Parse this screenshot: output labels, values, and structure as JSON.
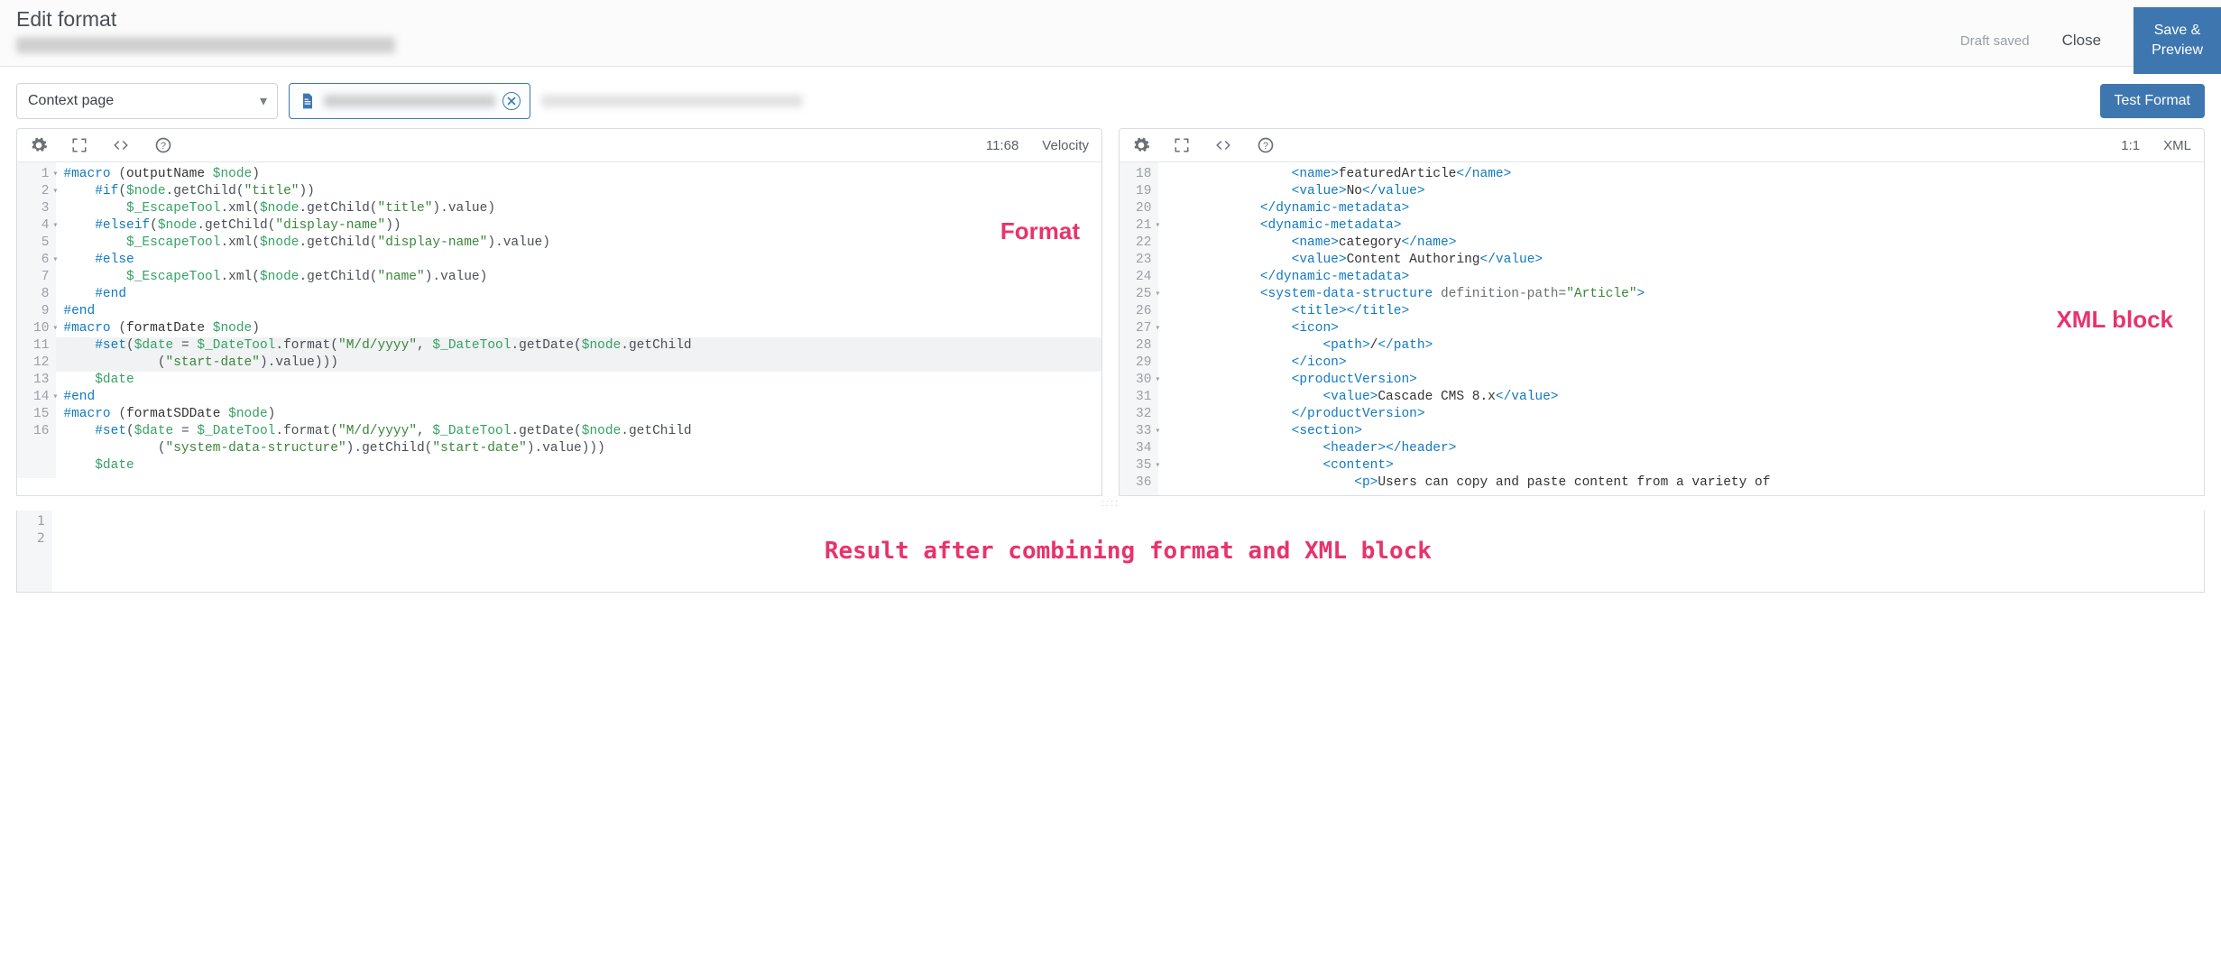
{
  "header": {
    "title": "Edit format",
    "draft_saved": "Draft saved",
    "close": "Close",
    "save_preview": "Save &\nPreview"
  },
  "controls": {
    "context_value": "Context page",
    "test_format": "Test Format"
  },
  "format_panel": {
    "cursor": "11:68",
    "lang": "Velocity",
    "annotation": "Format",
    "lines": [
      {
        "n": 1,
        "foldable": true,
        "indent": 0,
        "tokens": [
          [
            "dir",
            "#macro"
          ],
          [
            "punc",
            " ("
          ],
          [
            "text",
            "outputName "
          ],
          [
            "var",
            "$node"
          ],
          [
            "punc",
            ")"
          ]
        ]
      },
      {
        "n": 2,
        "foldable": true,
        "indent": 1,
        "tokens": [
          [
            "dir",
            "#if"
          ],
          [
            "punc",
            "("
          ],
          [
            "var",
            "$node"
          ],
          [
            "punc",
            ".getChild("
          ],
          [
            "str",
            "\"title\""
          ],
          [
            "punc",
            "))"
          ]
        ]
      },
      {
        "n": 3,
        "foldable": false,
        "indent": 2,
        "tokens": [
          [
            "var",
            "$_EscapeTool"
          ],
          [
            "punc",
            ".xml("
          ],
          [
            "var",
            "$node"
          ],
          [
            "punc",
            ".getChild("
          ],
          [
            "str",
            "\"title\""
          ],
          [
            "punc",
            ").value)"
          ]
        ]
      },
      {
        "n": 4,
        "foldable": true,
        "indent": 1,
        "tokens": [
          [
            "dir",
            "#elseif"
          ],
          [
            "punc",
            "("
          ],
          [
            "var",
            "$node"
          ],
          [
            "punc",
            ".getChild("
          ],
          [
            "str",
            "\"display-name\""
          ],
          [
            "punc",
            "))"
          ]
        ]
      },
      {
        "n": 5,
        "foldable": false,
        "indent": 2,
        "tokens": [
          [
            "var",
            "$_EscapeTool"
          ],
          [
            "punc",
            ".xml("
          ],
          [
            "var",
            "$node"
          ],
          [
            "punc",
            ".getChild("
          ],
          [
            "str",
            "\"display-name\""
          ],
          [
            "punc",
            ").value)"
          ]
        ]
      },
      {
        "n": 6,
        "foldable": true,
        "indent": 1,
        "tokens": [
          [
            "dir",
            "#else"
          ]
        ]
      },
      {
        "n": 7,
        "foldable": false,
        "indent": 2,
        "tokens": [
          [
            "var",
            "$_EscapeTool"
          ],
          [
            "punc",
            ".xml("
          ],
          [
            "var",
            "$node"
          ],
          [
            "punc",
            ".getChild("
          ],
          [
            "str",
            "\"name\""
          ],
          [
            "punc",
            ").value)"
          ]
        ]
      },
      {
        "n": 8,
        "foldable": false,
        "indent": 1,
        "tokens": [
          [
            "dir",
            "#end"
          ]
        ]
      },
      {
        "n": 9,
        "foldable": false,
        "indent": 0,
        "tokens": [
          [
            "dir",
            "#end"
          ]
        ]
      },
      {
        "n": 10,
        "foldable": true,
        "indent": 0,
        "tokens": [
          [
            "dir",
            "#macro"
          ],
          [
            "punc",
            " ("
          ],
          [
            "text",
            "formatDate "
          ],
          [
            "var",
            "$node"
          ],
          [
            "punc",
            ")"
          ]
        ]
      },
      {
        "n": 11,
        "foldable": false,
        "indent": 1,
        "hl": true,
        "tokens": [
          [
            "dir",
            "#set"
          ],
          [
            "punc",
            "("
          ],
          [
            "var",
            "$date"
          ],
          [
            "punc",
            " = "
          ],
          [
            "var",
            "$_DateTool"
          ],
          [
            "punc",
            ".format("
          ],
          [
            "str",
            "\"M/d/yyyy\""
          ],
          [
            "punc",
            ", "
          ],
          [
            "var",
            "$_DateTool"
          ],
          [
            "punc",
            ".getDate("
          ],
          [
            "var",
            "$node"
          ],
          [
            "punc",
            ".getChild"
          ]
        ]
      },
      {
        "n": "",
        "foldable": false,
        "indent": 3,
        "hl": true,
        "tokens": [
          [
            "punc",
            "("
          ],
          [
            "str",
            "\"start-date\""
          ],
          [
            "punc",
            ").value)))"
          ]
        ]
      },
      {
        "n": 12,
        "foldable": false,
        "indent": 1,
        "tokens": [
          [
            "var",
            "$date"
          ]
        ]
      },
      {
        "n": 13,
        "foldable": false,
        "indent": 0,
        "tokens": [
          [
            "dir",
            "#end"
          ]
        ]
      },
      {
        "n": 14,
        "foldable": true,
        "indent": 0,
        "tokens": [
          [
            "dir",
            "#macro"
          ],
          [
            "punc",
            " ("
          ],
          [
            "text",
            "formatSDDate "
          ],
          [
            "var",
            "$node"
          ],
          [
            "punc",
            ")"
          ]
        ]
      },
      {
        "n": 15,
        "foldable": false,
        "indent": 1,
        "tokens": [
          [
            "dir",
            "#set"
          ],
          [
            "punc",
            "("
          ],
          [
            "var",
            "$date"
          ],
          [
            "punc",
            " = "
          ],
          [
            "var",
            "$_DateTool"
          ],
          [
            "punc",
            ".format("
          ],
          [
            "str",
            "\"M/d/yyyy\""
          ],
          [
            "punc",
            ", "
          ],
          [
            "var",
            "$_DateTool"
          ],
          [
            "punc",
            ".getDate("
          ],
          [
            "var",
            "$node"
          ],
          [
            "punc",
            ".getChild"
          ]
        ]
      },
      {
        "n": "",
        "foldable": false,
        "indent": 3,
        "tokens": [
          [
            "punc",
            "("
          ],
          [
            "str",
            "\"system-data-structure\""
          ],
          [
            "punc",
            ").getChild("
          ],
          [
            "str",
            "\"start-date\""
          ],
          [
            "punc",
            ").value)))"
          ]
        ]
      },
      {
        "n": 16,
        "foldable": false,
        "indent": 1,
        "tokens": [
          [
            "var",
            "$date"
          ]
        ]
      }
    ]
  },
  "xml_panel": {
    "cursor": "1:1",
    "lang": "XML",
    "annotation": "XML block",
    "lines": [
      {
        "n": 18,
        "foldable": false,
        "indent": 4,
        "tokens": [
          [
            "tago",
            "name"
          ],
          [
            "text",
            "featuredArticle"
          ],
          [
            "tagc",
            "name"
          ]
        ]
      },
      {
        "n": 19,
        "foldable": false,
        "indent": 4,
        "tokens": [
          [
            "tago",
            "value"
          ],
          [
            "text",
            "No"
          ],
          [
            "tagc",
            "value"
          ]
        ]
      },
      {
        "n": 20,
        "foldable": false,
        "indent": 3,
        "tokens": [
          [
            "tagc",
            "dynamic-metadata"
          ]
        ]
      },
      {
        "n": 21,
        "foldable": true,
        "indent": 3,
        "tokens": [
          [
            "tago",
            "dynamic-metadata"
          ]
        ]
      },
      {
        "n": 22,
        "foldable": false,
        "indent": 4,
        "tokens": [
          [
            "tago",
            "name"
          ],
          [
            "text",
            "category"
          ],
          [
            "tagc",
            "name"
          ]
        ]
      },
      {
        "n": 23,
        "foldable": false,
        "indent": 4,
        "tokens": [
          [
            "tago",
            "value"
          ],
          [
            "text",
            "Content Authoring"
          ],
          [
            "tagc",
            "value"
          ]
        ]
      },
      {
        "n": 24,
        "foldable": false,
        "indent": 3,
        "tokens": [
          [
            "tagc",
            "dynamic-metadata"
          ]
        ]
      },
      {
        "n": 25,
        "foldable": true,
        "indent": 3,
        "tokens": [
          [
            "tagoa",
            "system-data-structure"
          ],
          [
            "attr",
            " definition-path="
          ],
          [
            "attv",
            "\"Article\""
          ],
          [
            "punc",
            ">"
          ]
        ]
      },
      {
        "n": 26,
        "foldable": false,
        "indent": 4,
        "tokens": [
          [
            "tago",
            "title"
          ],
          [
            "tagc",
            "title"
          ]
        ]
      },
      {
        "n": 27,
        "foldable": true,
        "indent": 4,
        "tokens": [
          [
            "tago",
            "icon"
          ]
        ]
      },
      {
        "n": 28,
        "foldable": false,
        "indent": 5,
        "tokens": [
          [
            "tago",
            "path"
          ],
          [
            "text",
            "/"
          ],
          [
            "tagc",
            "path"
          ]
        ]
      },
      {
        "n": 29,
        "foldable": false,
        "indent": 4,
        "tokens": [
          [
            "tagc",
            "icon"
          ]
        ]
      },
      {
        "n": 30,
        "foldable": true,
        "indent": 4,
        "tokens": [
          [
            "tago",
            "productVersion"
          ]
        ]
      },
      {
        "n": 31,
        "foldable": false,
        "indent": 5,
        "tokens": [
          [
            "tago",
            "value"
          ],
          [
            "text",
            "Cascade CMS 8.x"
          ],
          [
            "tagc",
            "value"
          ]
        ]
      },
      {
        "n": 32,
        "foldable": false,
        "indent": 4,
        "tokens": [
          [
            "tagc",
            "productVersion"
          ]
        ]
      },
      {
        "n": 33,
        "foldable": true,
        "indent": 4,
        "tokens": [
          [
            "tago",
            "section"
          ]
        ]
      },
      {
        "n": 34,
        "foldable": false,
        "indent": 5,
        "tokens": [
          [
            "tago",
            "header"
          ],
          [
            "tagc",
            "header"
          ]
        ]
      },
      {
        "n": 35,
        "foldable": true,
        "indent": 5,
        "tokens": [
          [
            "tago",
            "content"
          ]
        ]
      },
      {
        "n": 36,
        "foldable": false,
        "indent": 6,
        "tokens": [
          [
            "tago",
            "p"
          ],
          [
            "text",
            "Users can copy and paste content from a variety of"
          ]
        ]
      }
    ]
  },
  "result_panel": {
    "annotation": "Result after combining format and XML block",
    "lines": [
      1,
      2
    ]
  }
}
